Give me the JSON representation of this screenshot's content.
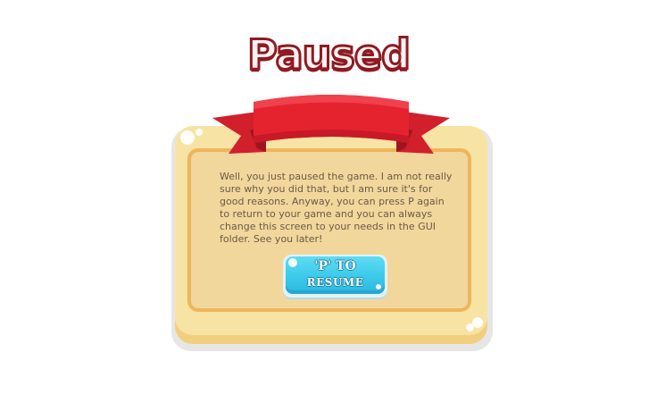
{
  "title": "Paused",
  "message": "Well, you just paused the game. I am not really sure why you did that, but I am sure it's for good reasons. Anyway, you can press P again to return to your game and you can always change this screen to your needs in the GUI folder. See you later!",
  "resume_button": {
    "line1": "'P' TO",
    "line2": "RESUME"
  },
  "colors": {
    "title_outline": "#8e1a22",
    "ribbon": "#e21f2d",
    "panel": "#f7e3a3",
    "panel_border": "#eeb55a",
    "button": "#3cc9ea",
    "text": "#6b5a45"
  }
}
